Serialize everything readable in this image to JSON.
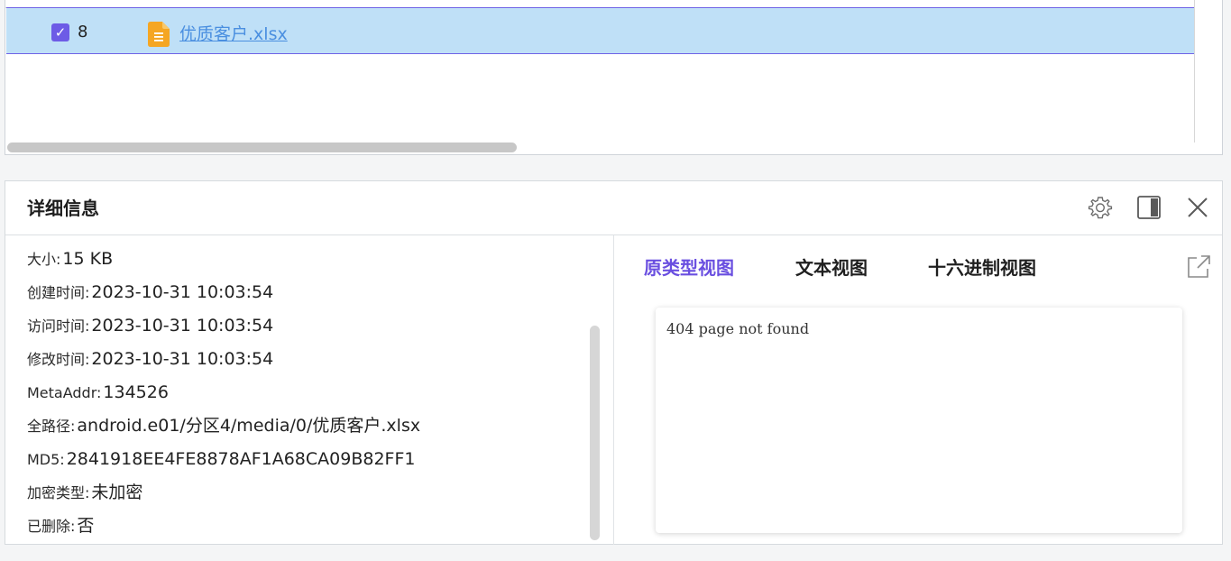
{
  "file_list": {
    "row": {
      "checked": true,
      "index": "8",
      "file_icon": "spreadsheet-file-icon",
      "file_name": "优质客户.xlsx"
    }
  },
  "details": {
    "title": "详细信息",
    "header_icons": [
      "gear-icon",
      "split-panel-icon",
      "close-icon"
    ],
    "info": {
      "size_label": "大小:",
      "size_value": "15 KB",
      "created_label": "创建时间:",
      "created_value": "2023-10-31 10:03:54",
      "accessed_label": "访问时间:",
      "accessed_value": "2023-10-31 10:03:54",
      "modified_label": "修改时间:",
      "modified_value": "2023-10-31 10:03:54",
      "meta_label": "MetaAddr:",
      "meta_value": "134526",
      "path_label": "全路径:",
      "path_value": "android.e01/分区4/media/0/优质客户.xlsx",
      "md5_label": "MD5:",
      "md5_value": "2841918EE4FE8878AF1A68CA09B82FF1",
      "enc_label": "加密类型:",
      "enc_value": "未加密",
      "deleted_label": "已删除:",
      "deleted_value": "否"
    },
    "tabs": [
      "原类型视图",
      "文本视图",
      "十六进制视图"
    ],
    "active_tab": "原类型视图",
    "preview_text": "404 page not found"
  },
  "colors": {
    "accent": "#6a4fe0",
    "selected_row": "#bfe0f7",
    "link": "#4a8fe0",
    "file_icon": "#f5a623"
  }
}
